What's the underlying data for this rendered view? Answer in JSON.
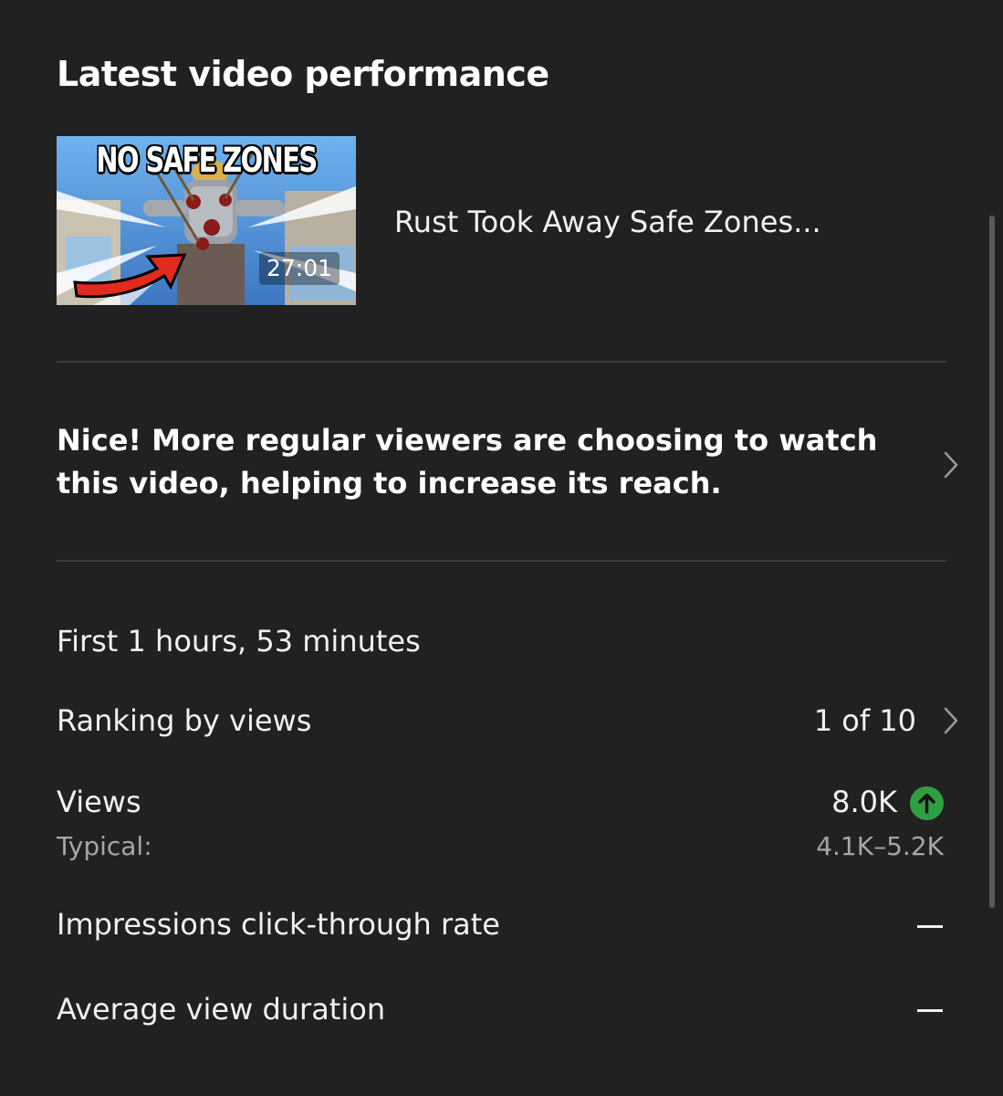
{
  "card": {
    "title": "Latest video performance"
  },
  "video": {
    "thumbnail_text": "NO SAFE ZONES",
    "duration": "27:01",
    "title": "Rust Took Away Safe Zones..."
  },
  "insight": {
    "text": "Nice! More regular viewers are choosing to watch this video, helping to increase its reach."
  },
  "stats": {
    "timeframe": "First 1 hours, 53 minutes",
    "ranking": {
      "label": "Ranking by views",
      "value": "1 of 10"
    },
    "views": {
      "label": "Views",
      "value": "8.0K",
      "typical_label": "Typical:",
      "typical_value": "4.1K–5.2K",
      "trend_icon": "arrow-up-icon",
      "trend_color": "#2ea043"
    },
    "ctr": {
      "label": "Impressions click-through rate",
      "value": "—"
    },
    "avg_duration": {
      "label": "Average view duration",
      "value": "—"
    }
  }
}
